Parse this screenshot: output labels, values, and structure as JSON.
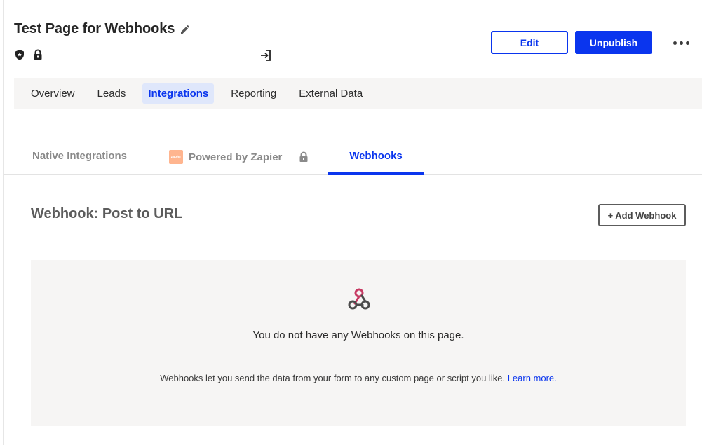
{
  "header": {
    "title": "Test Page for Webhooks",
    "edit_label": "Edit",
    "unpublish_label": "Unpublish"
  },
  "primary_nav": {
    "items": [
      {
        "label": "Overview"
      },
      {
        "label": "Leads"
      },
      {
        "label": "Integrations",
        "active": true
      },
      {
        "label": "Reporting"
      },
      {
        "label": "External Data"
      }
    ]
  },
  "subtabs": {
    "native": "Native Integrations",
    "zapier": "Powered by Zapier",
    "webhooks": "Webhooks",
    "zapier_logo_text": "zapier"
  },
  "section": {
    "title": "Webhook: Post to URL",
    "add_button": "+ Add Webhook"
  },
  "empty_state": {
    "title": "You do not have any Webhooks on this page.",
    "description": "Webhooks let you send the data from your form to any custom page or script you like.",
    "link": "Learn more."
  },
  "colors": {
    "accent": "#0a35ee",
    "panel_bg": "#f6f5f4",
    "active_tab_bg": "#dfe7fb",
    "zapier_orange": "#ffb58f"
  }
}
